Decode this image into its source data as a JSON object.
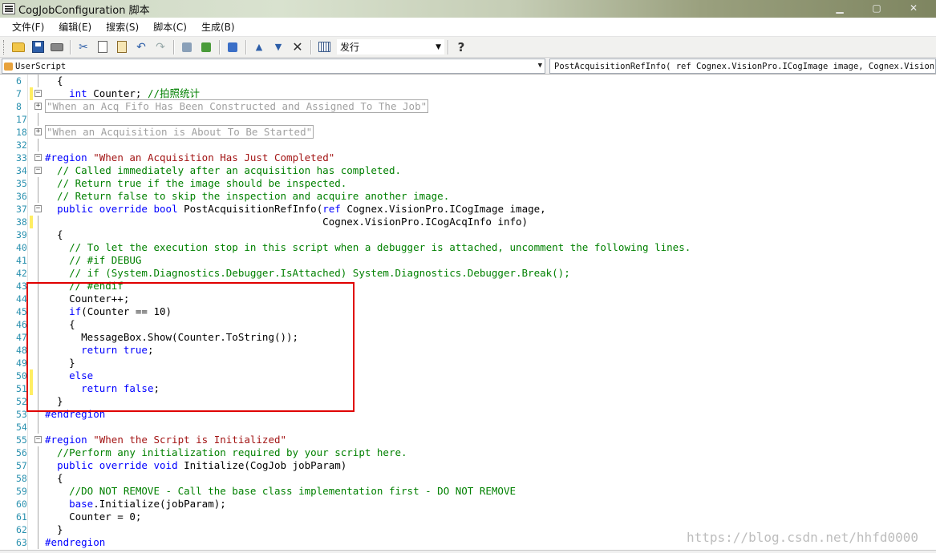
{
  "window": {
    "title": "CogJobConfiguration 脚本"
  },
  "menu": [
    "文件(F)",
    "编辑(E)",
    "搜索(S)",
    "脚本(C)",
    "生成(B)"
  ],
  "toolbar": {
    "build_mode": "发行"
  },
  "nav": {
    "left_combo": "UserScript",
    "right_combo": "PostAcquisitionRefInfo( ref Cognex.VisionPro.ICogImage image, Cognex.VisionPro.ICogAcqInfo info)"
  },
  "code_lines": [
    {
      "num": "6",
      "text": "  {",
      "kind": "plain"
    },
    {
      "num": "7",
      "text": "    int Counter; //拍照统计",
      "kind": "plain"
    },
    {
      "num": "8",
      "text": "\"When an Acq Fifo Has Been Constructed and Assigned To The Job\"",
      "kind": "collapsed"
    },
    {
      "num": "17",
      "text": "",
      "kind": "plain"
    },
    {
      "num": "18",
      "text": "\"When an Acquisition is About To Be Started\"",
      "kind": "collapsed"
    },
    {
      "num": "32",
      "text": "",
      "kind": "plain"
    },
    {
      "num": "33",
      "text": "#region \"When an Acquisition Has Just Completed\"",
      "kind": "plain"
    },
    {
      "num": "34",
      "text": "  // Called immediately after an acquisition has completed.",
      "kind": "comment"
    },
    {
      "num": "35",
      "text": "  // Return true if the image should be inspected.",
      "kind": "comment"
    },
    {
      "num": "36",
      "text": "  // Return false to skip the inspection and acquire another image.",
      "kind": "comment"
    },
    {
      "num": "37",
      "text": "  public override bool PostAcquisitionRefInfo(ref Cognex.VisionPro.ICogImage image,",
      "kind": "plain"
    },
    {
      "num": "38",
      "text": "                                              Cognex.VisionPro.ICogAcqInfo info)",
      "kind": "plain"
    },
    {
      "num": "39",
      "text": "  {",
      "kind": "plain"
    },
    {
      "num": "40",
      "text": "    // To let the execution stop in this script when a debugger is attached, uncomment the following lines.",
      "kind": "comment"
    },
    {
      "num": "41",
      "text": "    // #if DEBUG",
      "kind": "comment"
    },
    {
      "num": "42",
      "text": "    // if (System.Diagnostics.Debugger.IsAttached) System.Diagnostics.Debugger.Break();",
      "kind": "comment"
    },
    {
      "num": "43",
      "text": "    // #endif",
      "kind": "comment"
    },
    {
      "num": "44",
      "text": "    Counter++;",
      "kind": "plain"
    },
    {
      "num": "45",
      "text": "    if(Counter == 10)",
      "kind": "plain"
    },
    {
      "num": "46",
      "text": "    {",
      "kind": "plain"
    },
    {
      "num": "47",
      "text": "      MessageBox.Show(Counter.ToString());",
      "kind": "plain"
    },
    {
      "num": "48",
      "text": "      return true;",
      "kind": "plain"
    },
    {
      "num": "49",
      "text": "    }",
      "kind": "plain"
    },
    {
      "num": "50",
      "text": "    else",
      "kind": "plain"
    },
    {
      "num": "51",
      "text": "      return false;",
      "kind": "plain"
    },
    {
      "num": "52",
      "text": "  }",
      "kind": "plain"
    },
    {
      "num": "53",
      "text": "#endregion",
      "kind": "plain"
    },
    {
      "num": "54",
      "text": "",
      "kind": "plain"
    },
    {
      "num": "55",
      "text": "#region \"When the Script is Initialized\"",
      "kind": "plain"
    },
    {
      "num": "56",
      "text": "  //Perform any initialization required by your script here.",
      "kind": "comment"
    },
    {
      "num": "57",
      "text": "  public override void Initialize(CogJob jobParam)",
      "kind": "plain"
    },
    {
      "num": "58",
      "text": "  {",
      "kind": "plain"
    },
    {
      "num": "59",
      "text": "    //DO NOT REMOVE - Call the base class implementation first - DO NOT REMOVE",
      "kind": "comment"
    },
    {
      "num": "60",
      "text": "    base.Initialize(jobParam);",
      "kind": "plain"
    },
    {
      "num": "61",
      "text": "    Counter = 0;",
      "kind": "plain"
    },
    {
      "num": "62",
      "text": "  }",
      "kind": "plain"
    },
    {
      "num": "63",
      "text": "#endregion",
      "kind": "plain"
    }
  ],
  "changed_lines": [
    "7",
    "38",
    "50",
    "51"
  ],
  "fold_lines": [
    "7",
    "8",
    "18",
    "33",
    "34",
    "37",
    "55"
  ],
  "watermark": "https://blog.csdn.net/hhfd0000",
  "colors": {
    "keyword": "#0000ff",
    "string": "#a31515",
    "comment": "#008000",
    "line_number": "#2b91af",
    "highlight_box": "#e00000"
  }
}
